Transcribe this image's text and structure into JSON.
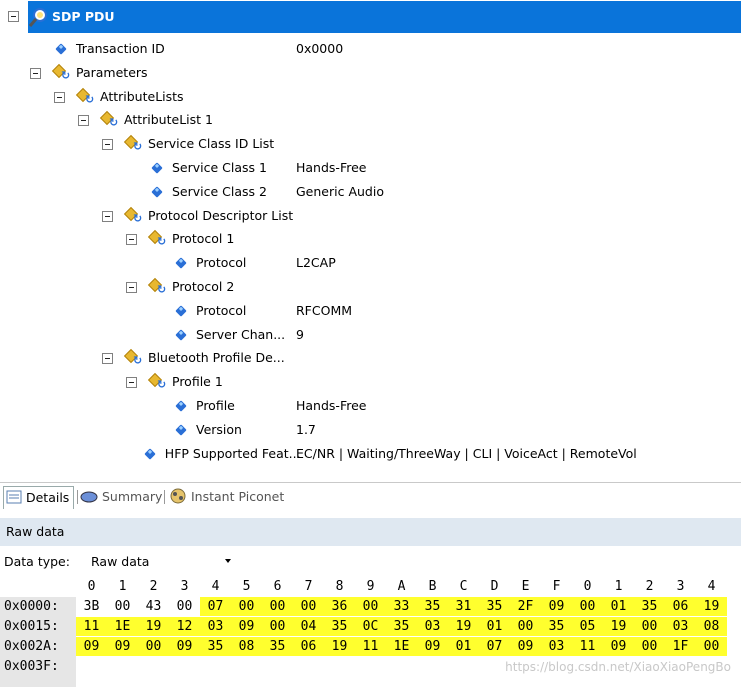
{
  "tree": {
    "header_title": "SDP PDU",
    "rows": [
      {
        "label": "Transaction ID",
        "value": "0x0000"
      },
      {
        "label": "Parameters",
        "value": ""
      },
      {
        "label": "AttributeLists",
        "value": ""
      },
      {
        "label": "AttributeList 1",
        "value": ""
      },
      {
        "label": "Service Class ID List",
        "value": ""
      },
      {
        "label": "Service Class 1",
        "value": "Hands-Free"
      },
      {
        "label": "Service Class 2",
        "value": "Generic Audio"
      },
      {
        "label": "Protocol Descriptor List",
        "value": ""
      },
      {
        "label": "Protocol 1",
        "value": ""
      },
      {
        "label": "Protocol",
        "value": "L2CAP"
      },
      {
        "label": "Protocol 2",
        "value": ""
      },
      {
        "label": "Protocol",
        "value": "RFCOMM"
      },
      {
        "label": "Server Chan...",
        "value": "9"
      },
      {
        "label": "Bluetooth Profile De...",
        "value": ""
      },
      {
        "label": "Profile 1",
        "value": ""
      },
      {
        "label": "Profile",
        "value": "Hands-Free"
      },
      {
        "label": "Version",
        "value": "1.7"
      },
      {
        "label": "HFP Supported Feat...",
        "value": "EC/NR | Waiting/ThreeWay | CLI | VoiceAct | RemoteVol"
      }
    ]
  },
  "tabs": [
    {
      "label": "Details",
      "active": true
    },
    {
      "label": "Summary",
      "active": false
    },
    {
      "label": "Instant Piconet",
      "active": false
    }
  ],
  "raw": {
    "title": "Raw data",
    "data_type_label": "Data type:",
    "data_type_value": "Raw data",
    "columns": [
      "0",
      "1",
      "2",
      "3",
      "4",
      "5",
      "6",
      "7",
      "8",
      "9",
      "A",
      "B",
      "C",
      "D",
      "E",
      "F",
      "0",
      "1",
      "2",
      "3",
      "4"
    ],
    "offsets": [
      "0x0000:",
      "0x0015:",
      "0x002A:",
      "0x003F:"
    ],
    "rows": [
      [
        "3B",
        "00",
        "43",
        "00",
        "07",
        "00",
        "00",
        "00",
        "36",
        "00",
        "33",
        "35",
        "31",
        "35",
        "2F",
        "09",
        "00",
        "01",
        "35",
        "06",
        "19"
      ],
      [
        "11",
        "1E",
        "19",
        "12",
        "03",
        "09",
        "00",
        "04",
        "35",
        "0C",
        "35",
        "03",
        "19",
        "01",
        "00",
        "35",
        "05",
        "19",
        "00",
        "03",
        "08"
      ],
      [
        "09",
        "09",
        "00",
        "09",
        "35",
        "08",
        "35",
        "06",
        "19",
        "11",
        "1E",
        "09",
        "01",
        "07",
        "09",
        "03",
        "11",
        "09",
        "00",
        "1F",
        "00"
      ]
    ],
    "highlight_start_col": 4
  },
  "watermark": "https://blog.csdn.net/XiaoXiaoPengBo",
  "colors": {
    "header_blue": "#0a74da",
    "highlight": "#ffff2e",
    "raw_title_bg": "#dfe8f1"
  }
}
